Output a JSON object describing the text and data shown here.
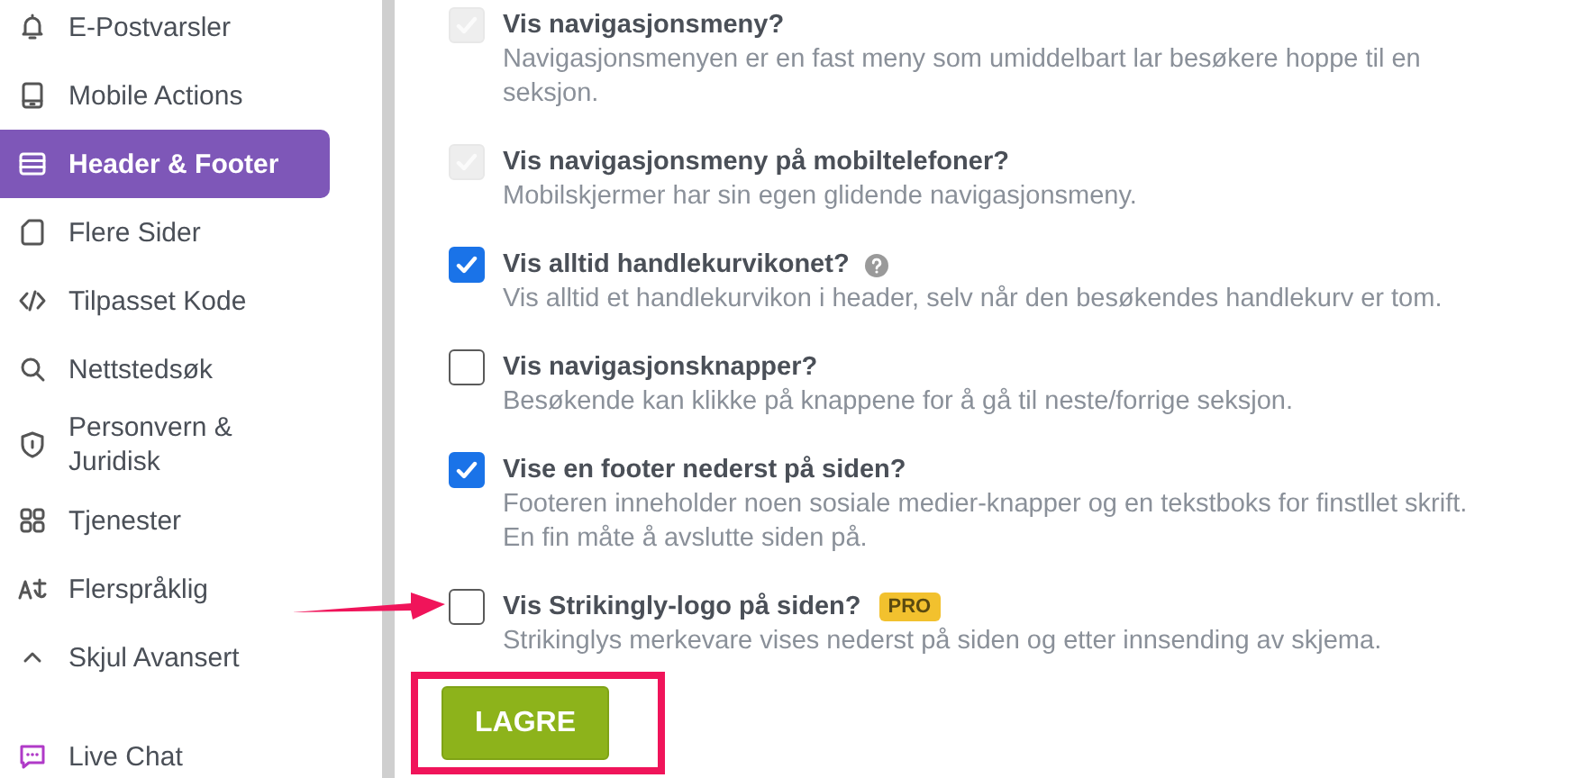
{
  "sidebar": {
    "items": [
      {
        "label": "E-Postvarsler",
        "selected": false
      },
      {
        "label": "Mobile Actions",
        "selected": false
      },
      {
        "label": "Header & Footer",
        "selected": true
      },
      {
        "label": "Flere Sider",
        "selected": false
      },
      {
        "label": "Tilpasset Kode",
        "selected": false
      },
      {
        "label": "Nettstedsøk",
        "selected": false
      },
      {
        "label": "Personvern & Juridisk",
        "selected": false
      },
      {
        "label": "Tjenester",
        "selected": false
      },
      {
        "label": "Flerspråklig",
        "selected": false
      }
    ],
    "advanced_toggle": {
      "label": "Skjul Avansert",
      "expanded": true
    },
    "footer_items": [
      {
        "label": "Live Chat"
      }
    ]
  },
  "settings": [
    {
      "title": "Vis navigasjonsmeny?",
      "description": "Navigasjonsmenyen er en fast meny som umiddelbart lar besøkere hoppe til en seksjon.",
      "checked": true,
      "disabled": true,
      "help": false
    },
    {
      "title": "Vis navigasjonsmeny på mobiltelefoner?",
      "description": "Mobilskjermer har sin egen glidende navigasjonsmeny.",
      "checked": true,
      "disabled": true,
      "help": false
    },
    {
      "title": "Vis alltid handlekurvikonet?",
      "description": "Vis alltid et handlekurvikon i header, selv når den besøkendes handlekurv er tom.",
      "checked": true,
      "disabled": false,
      "help": true
    },
    {
      "title": "Vis navigasjonsknapper?",
      "description": "Besøkende kan klikke på knappene for å gå til neste/forrige seksjon.",
      "checked": false,
      "disabled": false,
      "help": false
    },
    {
      "title": "Vise en footer nederst på siden?",
      "description": "Footeren inneholder noen sosiale medier-knapper og en tekstboks for finstllet skrift. En fin måte å avslutte siden på.",
      "checked": true,
      "disabled": false,
      "help": false
    },
    {
      "title": "Vis Strikingly-logo på siden?",
      "description": "Strikinglys merkevare vises nederst på siden og etter innsending av skjema.",
      "checked": false,
      "disabled": false,
      "help": false,
      "badge": "PRO"
    }
  ],
  "save_button": {
    "label": "LAGRE"
  }
}
